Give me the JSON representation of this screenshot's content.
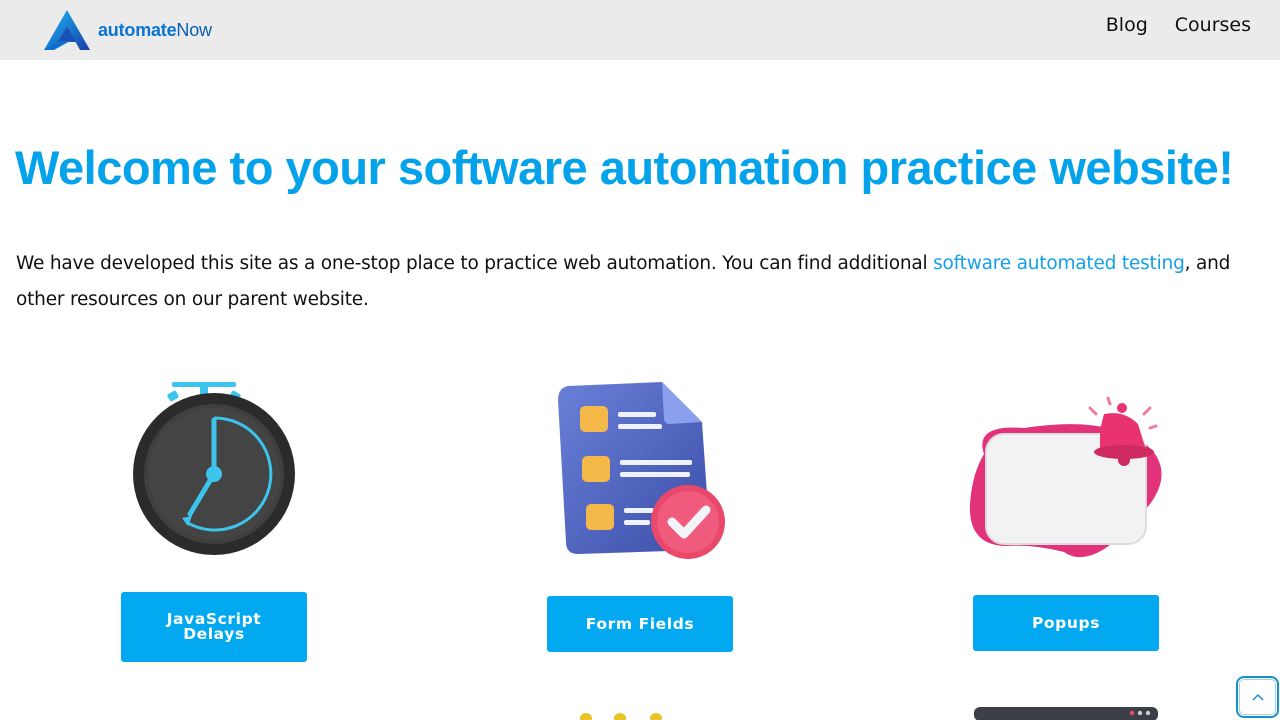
{
  "header": {
    "logo_text_bold": "automate",
    "logo_text_regular": "Now",
    "nav": [
      {
        "label": "Blog"
      },
      {
        "label": "Courses"
      }
    ]
  },
  "main": {
    "headline": "Welcome to your software automation practice website!",
    "intro_before": "We have developed this site as a one-stop place to practice web automation. You can find additional ",
    "intro_link": "software automated testing",
    "intro_after": ", and other resources on our parent website."
  },
  "cards": [
    {
      "label": "JavaScript Delays",
      "icon": "stopwatch-icon"
    },
    {
      "label": "Form Fields",
      "icon": "form-checklist-icon"
    },
    {
      "label": "Popups",
      "icon": "popup-bell-icon"
    }
  ],
  "colors": {
    "accent": "#03a9f0",
    "headline": "#03a2ea",
    "header_bg": "#ebebeb"
  },
  "scroll_top": {
    "icon": "chevron-up-icon"
  }
}
